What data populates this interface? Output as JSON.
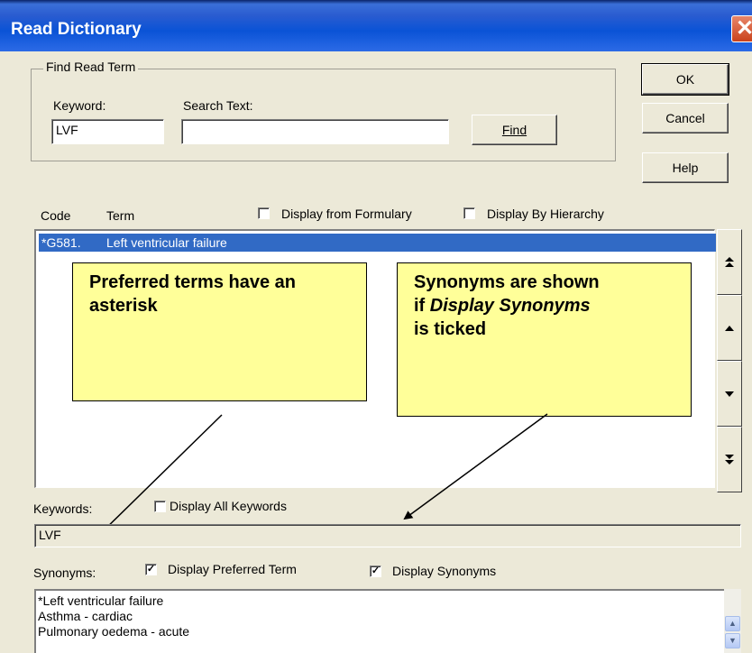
{
  "window": {
    "title": "Read Dictionary",
    "close_glyph": "✕"
  },
  "find_group": {
    "title": "Find Read Term",
    "keyword_label": "Keyword:",
    "keyword_value": "LVF",
    "search_text_label": "Search Text:",
    "search_text_value": "",
    "find_label": "Find"
  },
  "buttons": {
    "ok": "OK",
    "cancel": "Cancel",
    "help": "Help"
  },
  "list_header": {
    "code": "Code",
    "term": "Term",
    "display_from_formulary": "Display from Formulary",
    "display_by_hierarchy": "Display By Hierarchy",
    "display_from_formulary_checked": false,
    "display_by_hierarchy_checked": false
  },
  "terms": [
    {
      "code": "*G581.",
      "term": "Left ventricular failure",
      "selected": true
    }
  ],
  "scroll_buttons": [
    "first-icon",
    "up-icon",
    "down-icon",
    "last-icon"
  ],
  "callouts": {
    "preferred": "Preferred terms have an asterisk",
    "synonyms_line1": "Synonyms are shown",
    "synonyms_line2_pre": "if ",
    "synonyms_line2_italic": "Display Synonyms",
    "synonyms_line3": "is ticked"
  },
  "keywords": {
    "label": "Keywords:",
    "display_all_label": "Display All Keywords",
    "display_all_checked": false,
    "value": "LVF"
  },
  "synonyms": {
    "label": "Synonyms:",
    "display_preferred_label": "Display Preferred Term",
    "display_preferred_checked": true,
    "display_synonyms_label": "Display Synonyms",
    "display_synonyms_checked": true,
    "items": [
      "*Left ventricular failure",
      "Asthma - cardiac",
      "Pulmonary oedema - acute"
    ]
  },
  "colors": {
    "title_bar": "#0a53d6",
    "selection": "#316ac5",
    "callout": "#ffff99",
    "dialog": "#ece9d8"
  }
}
